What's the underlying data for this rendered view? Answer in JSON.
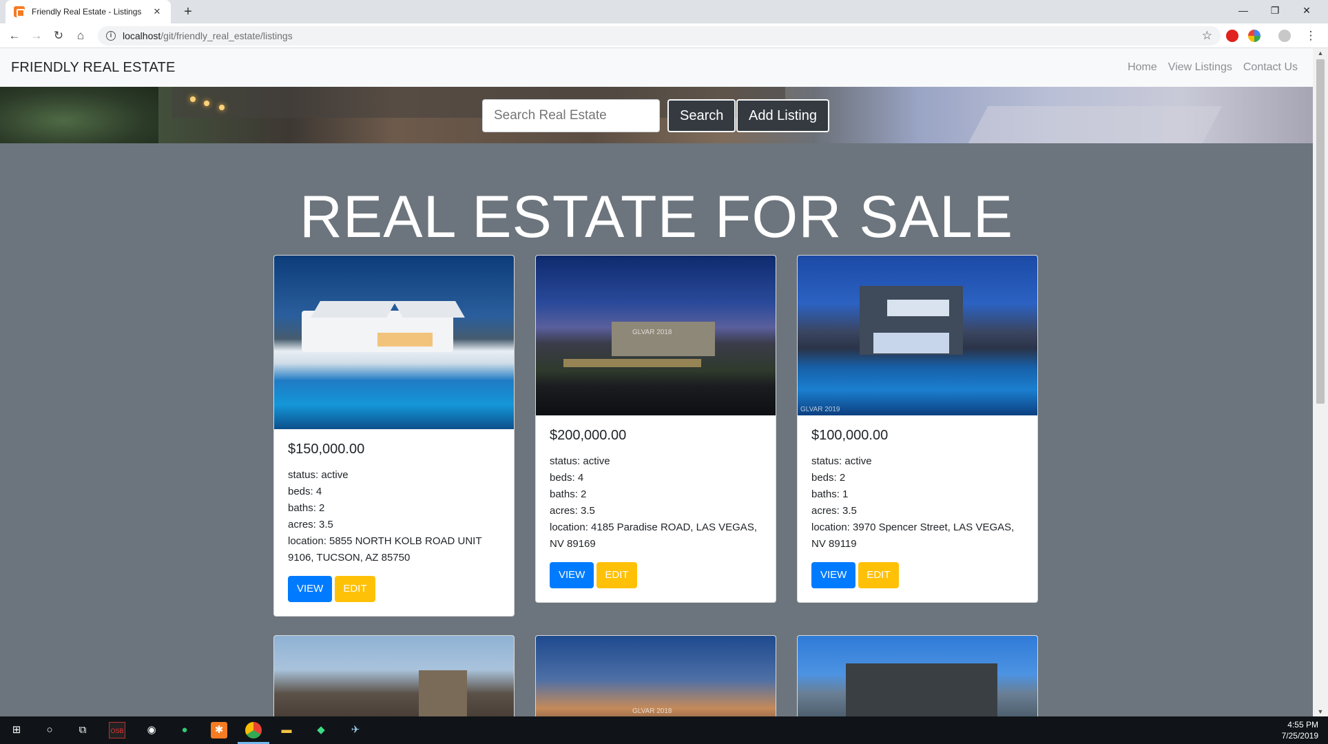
{
  "browser": {
    "tab_title": "Friendly Real Estate - Listings",
    "tab_close": "✕",
    "new_tab": "+",
    "url_host": "localhost",
    "url_path": "/git/friendly_real_estate/listings",
    "win_minimize": "—",
    "win_restore": "❐",
    "win_close": "✕"
  },
  "navbar": {
    "brand": "FRIENDLY REAL ESTATE",
    "links": [
      "Home",
      "View Listings",
      "Contact Us"
    ]
  },
  "search": {
    "placeholder": "Search Real Estate",
    "search_label": "Search",
    "add_label": "Add Listing"
  },
  "heading": "REAL ESTATE FOR SALE",
  "listings": [
    {
      "price": "$150,000.00",
      "status": "status: active",
      "beds": "beds: 4",
      "baths": "baths: 2",
      "acres": "acres: 3.5",
      "location": "location: 5855 NORTH KOLB ROAD UNIT 9106, TUCSON, AZ 85750",
      "view": "VIEW",
      "edit": "EDIT"
    },
    {
      "price": "$200,000.00",
      "status": "status: active",
      "beds": "beds: 4",
      "baths": "baths: 2",
      "acres": "acres: 3.5",
      "location": "location: 4185 Paradise ROAD, LAS VEGAS, NV 89169",
      "view": "VIEW",
      "edit": "EDIT",
      "watermark": "GLVAR 2018"
    },
    {
      "price": "$100,000.00",
      "status": "status: active",
      "beds": "beds: 2",
      "baths": "baths: 1",
      "acres": "acres: 3.5",
      "location": "location: 3970 Spencer Street, LAS VEGAS, NV 89119",
      "view": "VIEW",
      "edit": "EDIT",
      "watermark": "GLVAR 2019"
    }
  ],
  "second_row_watermark": "GLVAR 2018",
  "taskbar": {
    "time": "4:55 PM",
    "date": "7/25/2019"
  },
  "colors": {
    "page_bg": "#6c757d",
    "primary": "#007bff",
    "warning": "#ffc107",
    "dark": "#343a40"
  }
}
